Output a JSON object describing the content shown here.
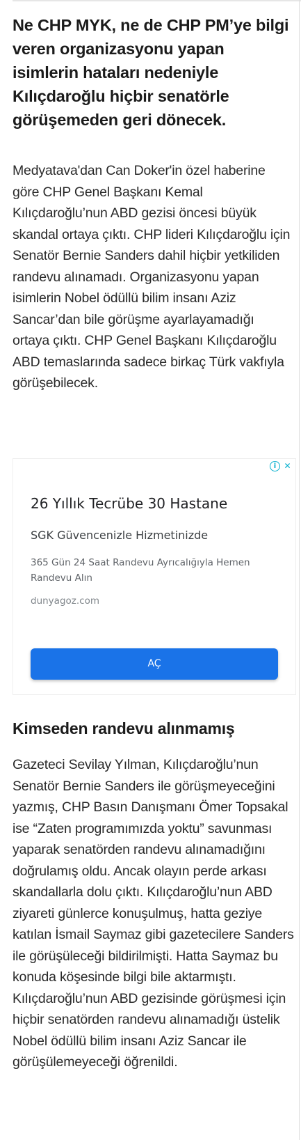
{
  "lead": "Ne CHP MYK, ne de CHP PM’ye bilgi veren organizasyonu yapan isimlerin hataları nedeniyle Kılıçdaroğlu hiçbir senatörle görüşemeden geri dönecek.",
  "paragraph1": "Medyatava'dan Can Doker'in özel haberine göre CHP Genel Başkanı Kemal Kılıçdaroğlu’nun ABD gezisi öncesi büyük skandal ortaya çıktı. CHP lideri Kılıçdaroğlu için Senatör Bernie Sanders dahil hiçbir yetkiliden randevu alınamadı. Organizasyonu yapan isimlerin Nobel ödüllü bilim insanı Aziz Sancar’dan bile görüşme ayarlayamadığı ortaya çıktı. CHP Genel Başkanı Kılıçdaroğlu ABD temaslarında sadece birkaç Türk vakfıyla görüşebilecek.",
  "ad": {
    "title": "26 Yıllık Tecrübe 30 Hastane",
    "subtitle": "SGK Güvencenizle Hizmetinizde",
    "description": "365 Gün 24 Saat Randevu Ayrıcalığıyla Hemen Randevu Alın",
    "domain": "dunyagoz.com",
    "button": "AÇ",
    "accent": "#1a73e8",
    "badge_color": "#00aecd",
    "icons": [
      "info-icon",
      "close-icon"
    ]
  },
  "subheading": "Kimseden randevu alınmamış",
  "paragraph2": "Gazeteci Sevilay Yılman, Kılıçdaroğlu’nun Senatör Bernie Sanders ile görüşmeyeceğini yazmış, CHP Basın Danışmanı Ömer Topsakal ise “Zaten programımızda yoktu” savunması yaparak senatörden randevu alınamadığını doğrulamış oldu. Ancak olayın perde arkası skandallarla dolu çıktı. Kılıçdaroğlu’nun ABD ziyareti günlerce konuşulmuş, hatta geziye katılan İsmail Saymaz gibi gazetecilere Sanders ile görüşüleceği bildirilmişti. Hatta Saymaz bu konuda köşesinde bilgi bile aktarmıştı. Kılıçdaroğlu’nun ABD gezisinde görüşmesi için hiçbir senatörden randevu alınamadığı üstelik Nobel ödüllü bilim insanı Aziz Sancar ile görüşülemeyeceği öğrenildi."
}
